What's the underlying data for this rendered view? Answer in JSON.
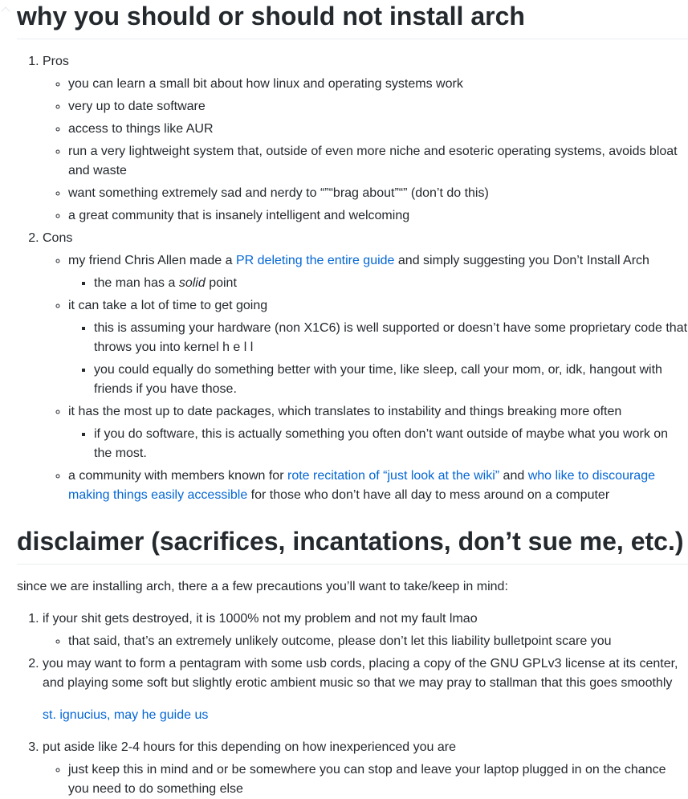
{
  "section1": {
    "heading": "why you should or should not install arch",
    "pros": {
      "label": "Pros",
      "items": [
        "you can learn a small bit about how linux and operating systems work",
        "very up to date software",
        "access to things like AUR",
        "run a very lightweight system that, outside of even more niche and esoteric operating systems, avoids bloat and waste",
        "want something extremely sad and nerdy to “”“brag about”“” (don’t do this)",
        "a great community that is insanely intelligent and welcoming"
      ]
    },
    "cons": {
      "label": "Cons",
      "item1": {
        "before": "my friend Chris Allen made a ",
        "link": "PR deleting the entire guide",
        "after": " and simply suggesting you Don’t Install Arch",
        "sub1_before": "the man has a ",
        "sub1_em": "solid",
        "sub1_after": " point"
      },
      "item2": {
        "text": "it can take a lot of time to get going",
        "sub1": "this is assuming your hardware (non X1C6) is well supported or doesn’t have some proprietary code that throws you into kernel h e l l",
        "sub2": "you could equally do something better with your time, like sleep, call your mom, or, idk, hangout with friends if you have those."
      },
      "item3": {
        "text": "it has the most up to date packages, which translates to instability and things breaking more often",
        "sub1": "if you do software, this is actually something you often don’t want outside of maybe what you work on the most."
      },
      "item4": {
        "before": "a community with members known for ",
        "link1": "rote recitation of “just look at the wiki”",
        "middle": " and ",
        "link2": "who like to discourage making things easily accessible",
        "after": " for those who don’t have all day to mess around on a computer"
      }
    }
  },
  "section2": {
    "heading": "disclaimer (sacrifices, incantations, don’t sue me, etc.)",
    "intro": "since we are installing arch, there a a few precautions you’ll want to take/keep in mind:",
    "item1": {
      "text": "if your shit gets destroyed, it is 1000% not my problem and not my fault lmao",
      "sub1": "that said, that’s an extremely unlikely outcome, please don’t let this liability bulletpoint scare you"
    },
    "item2": {
      "text": "you may want to form a pentagram with some usb cords, placing a copy of the GNU GPLv3 license at its center, and playing some soft but slightly erotic ambient music so that we may pray to stallman that this goes smoothly",
      "link": "st. ignucius, may he guide us"
    },
    "item3": {
      "text": "put aside like 2-4 hours for this depending on how inexperienced you are",
      "sub1": "just keep this in mind and or be somewhere you can stop and leave your laptop plugged in on the chance you need to do something else"
    }
  },
  "colors": {
    "text": "#24292e",
    "link": "#0366d6",
    "rule": "#eaecef"
  }
}
